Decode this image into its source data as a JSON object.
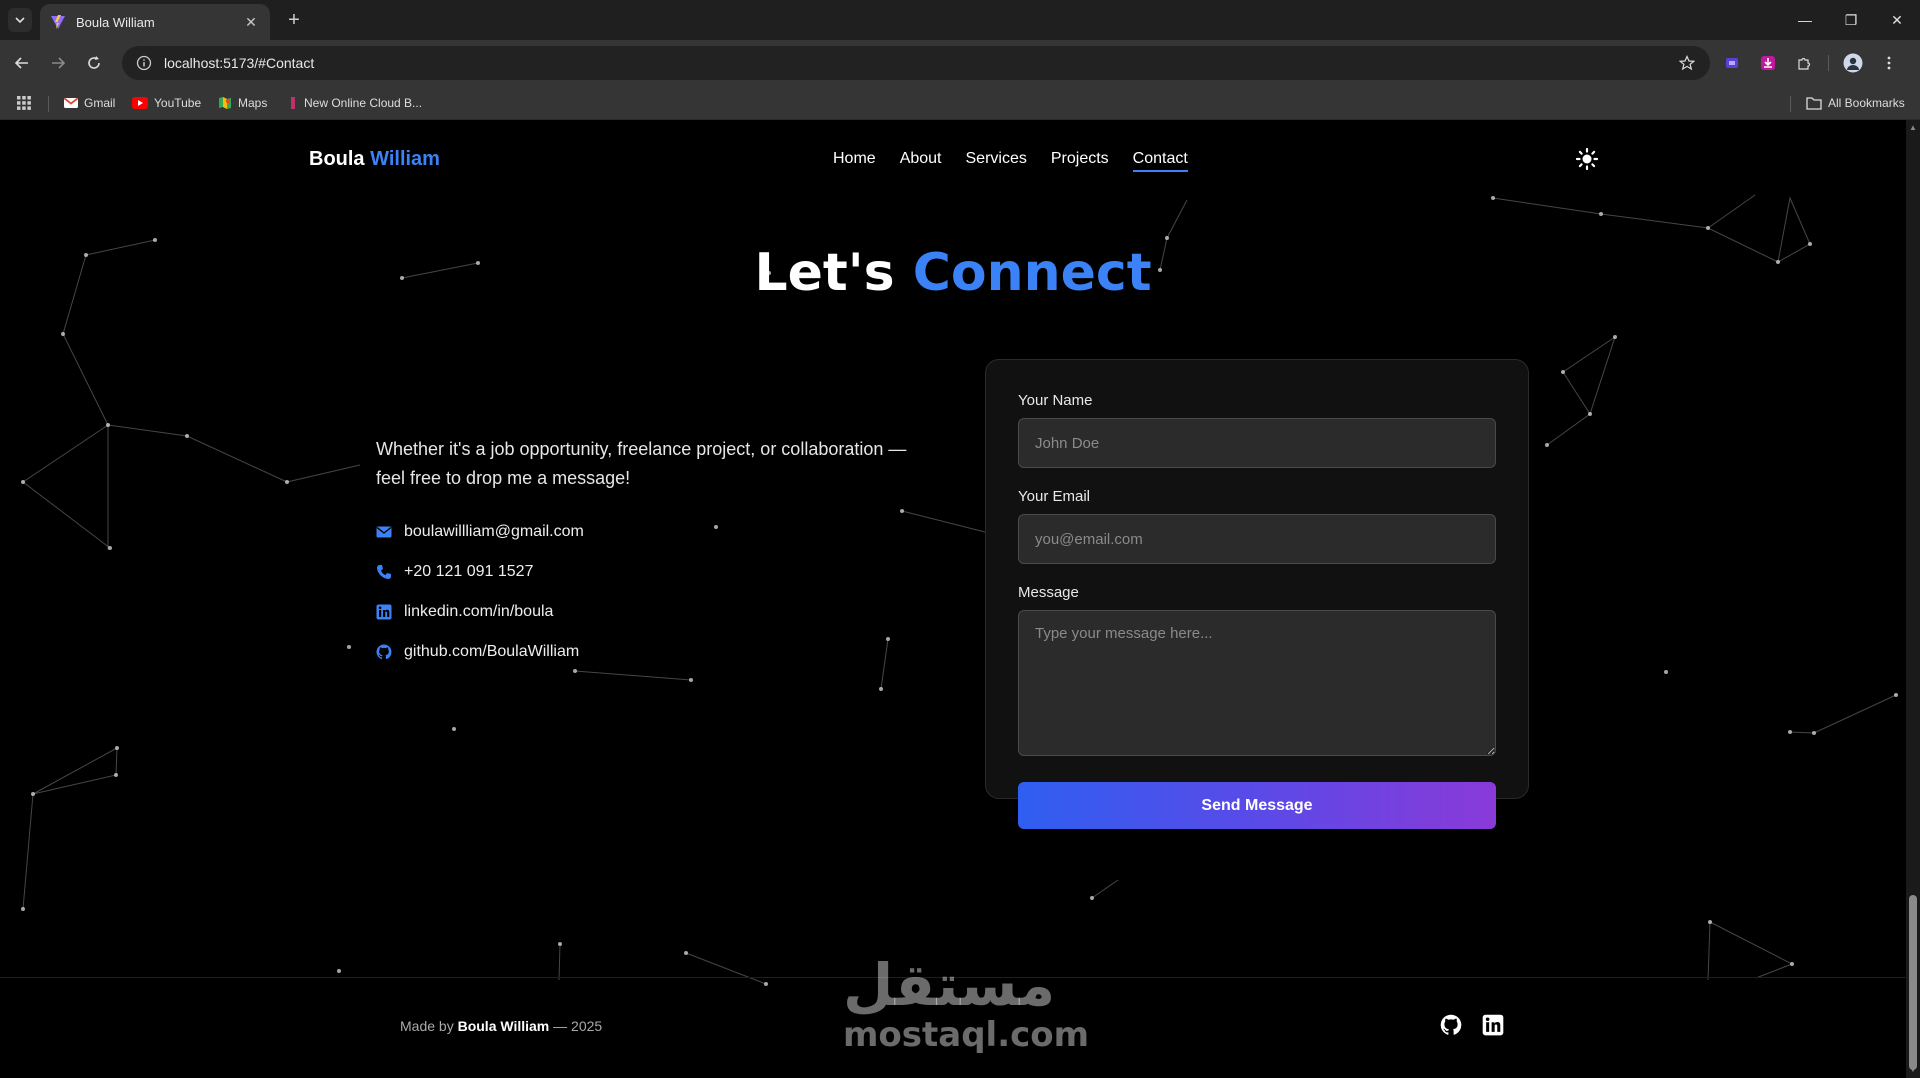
{
  "browser": {
    "tab_title": "Boula William",
    "url": "localhost:5173/#Contact",
    "bookmarks": [
      "Gmail",
      "YouTube",
      "Maps",
      "New Online Cloud B..."
    ],
    "all_bookmarks": "All Bookmarks"
  },
  "nav": {
    "brand_first": "Boula",
    "brand_second": "William",
    "links": [
      "Home",
      "About",
      "Services",
      "Projects",
      "Contact"
    ],
    "active": "Contact"
  },
  "hero": {
    "headline_first": "Let's",
    "headline_accent": "Connect"
  },
  "contact": {
    "intro": "Whether it's a job opportunity, freelance project, or collaboration — feel free to drop me a message!",
    "email": "boulawillliam@gmail.com",
    "phone": "+20 121 091 1527",
    "linkedin": "linkedin.com/in/boula",
    "github": "github.com/BoulaWilliam"
  },
  "form": {
    "name_label": "Your Name",
    "name_placeholder": "John Doe",
    "email_label": "Your Email",
    "email_placeholder": "you@email.com",
    "message_label": "Message",
    "message_placeholder": "Type your message here...",
    "submit_label": "Send Message"
  },
  "footer": {
    "made_by": "Made by",
    "author": "Boula William",
    "year": "— 2025"
  },
  "watermark": {
    "arabic": "مستقل",
    "latin": "mostaql.com"
  },
  "colors": {
    "accent": "#3b82f6",
    "gradient_start": "#2f5ff0",
    "gradient_end": "#8a3ad8",
    "background": "#000000"
  }
}
